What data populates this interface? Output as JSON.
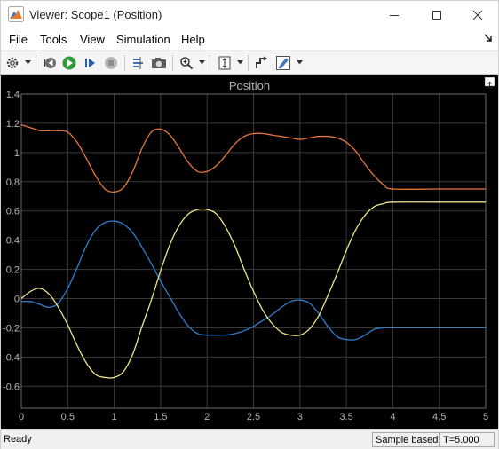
{
  "window": {
    "title": "Viewer: Scope1 (Position)"
  },
  "menu": {
    "items": [
      "File",
      "Tools",
      "View",
      "Simulation",
      "Help"
    ]
  },
  "toolbar": {
    "buttons": [
      "settings-icon",
      "step-back-icon",
      "run-icon",
      "step-forward-icon",
      "stop-icon",
      "highlight-signal-icon",
      "snapshot-icon",
      "zoom-in-icon",
      "scale-axes-icon",
      "signal-select-icon",
      "style-icon"
    ]
  },
  "plot": {
    "title": "Position"
  },
  "status": {
    "state": "Ready",
    "mode": "Sample based",
    "time": "T=5.000"
  },
  "colors": {
    "background": "#000000",
    "grid": "#3a3a3a",
    "axes_text": "#b4b4b4",
    "orange": "#e8753a",
    "blue": "#2f7fd1",
    "yellow": "#efe389"
  },
  "chart_data": {
    "type": "line",
    "title": "Position",
    "xlim": [
      0,
      5
    ],
    "ylim": [
      -0.75,
      1.4
    ],
    "xticks": [
      0,
      0.5,
      1,
      1.5,
      2,
      2.5,
      3,
      3.5,
      4,
      4.5,
      5
    ],
    "xtick_labels": [
      "0",
      "0.5",
      "1",
      "1.5",
      "2",
      "2.5",
      "3",
      "3.5",
      "4",
      "4.5",
      "5"
    ],
    "yticks": [
      -0.6,
      -0.4,
      -0.2,
      0,
      0.2,
      0.4,
      0.6,
      0.8,
      1,
      1.2,
      1.4
    ],
    "ytick_labels": [
      "-0.6",
      "-0.4",
      "-0.2",
      "0",
      "0.2",
      "0.4",
      "0.6",
      "0.8",
      "1",
      "1.2",
      "1.4"
    ],
    "grid": true,
    "series": [
      {
        "color": "#e8753a",
        "x": [
          0,
          0.1,
          0.2,
          0.3,
          0.4,
          0.5,
          0.6,
          0.7,
          0.8,
          0.9,
          1.0,
          1.1,
          1.2,
          1.3,
          1.4,
          1.5,
          1.6,
          1.7,
          1.8,
          1.9,
          2.0,
          2.1,
          2.2,
          2.3,
          2.4,
          2.5,
          2.6,
          2.7,
          2.8,
          2.9,
          3.0,
          3.1,
          3.2,
          3.3,
          3.4,
          3.5,
          3.6,
          3.7,
          3.8,
          3.9,
          4.0,
          4.5,
          5.0
        ],
        "y": [
          1.19,
          1.17,
          1.15,
          1.15,
          1.15,
          1.14,
          1.07,
          0.96,
          0.84,
          0.75,
          0.73,
          0.76,
          0.87,
          1.03,
          1.14,
          1.16,
          1.12,
          1.03,
          0.93,
          0.87,
          0.87,
          0.91,
          0.98,
          1.06,
          1.11,
          1.13,
          1.13,
          1.12,
          1.11,
          1.1,
          1.09,
          1.1,
          1.11,
          1.11,
          1.1,
          1.07,
          1.01,
          0.92,
          0.84,
          0.78,
          0.75,
          0.75,
          0.75
        ]
      },
      {
        "color": "#2f7fd1",
        "x": [
          0,
          0.1,
          0.2,
          0.3,
          0.4,
          0.5,
          0.6,
          0.7,
          0.8,
          0.9,
          1.0,
          1.1,
          1.2,
          1.3,
          1.4,
          1.5,
          1.6,
          1.7,
          1.8,
          1.9,
          2.0,
          2.1,
          2.2,
          2.3,
          2.4,
          2.5,
          2.6,
          2.7,
          2.8,
          2.9,
          3.0,
          3.1,
          3.2,
          3.3,
          3.4,
          3.5,
          3.6,
          3.7,
          3.8,
          3.9,
          4.0,
          4.5,
          5.0
        ],
        "y": [
          -0.02,
          -0.02,
          -0.04,
          -0.06,
          -0.03,
          0.07,
          0.21,
          0.36,
          0.47,
          0.52,
          0.53,
          0.51,
          0.45,
          0.35,
          0.24,
          0.12,
          0.01,
          -0.1,
          -0.19,
          -0.24,
          -0.25,
          -0.25,
          -0.25,
          -0.24,
          -0.22,
          -0.19,
          -0.15,
          -0.11,
          -0.06,
          -0.02,
          -0.01,
          -0.03,
          -0.1,
          -0.19,
          -0.26,
          -0.28,
          -0.28,
          -0.25,
          -0.21,
          -0.2,
          -0.2,
          -0.2,
          -0.2
        ]
      },
      {
        "color": "#efe389",
        "x": [
          0,
          0.1,
          0.2,
          0.3,
          0.4,
          0.5,
          0.6,
          0.7,
          0.8,
          0.9,
          1.0,
          1.1,
          1.2,
          1.3,
          1.4,
          1.5,
          1.6,
          1.7,
          1.8,
          1.9,
          2.0,
          2.1,
          2.2,
          2.3,
          2.4,
          2.5,
          2.6,
          2.7,
          2.8,
          2.9,
          3.0,
          3.1,
          3.2,
          3.3,
          3.4,
          3.5,
          3.6,
          3.7,
          3.8,
          3.9,
          4.0,
          4.5,
          5.0
        ],
        "y": [
          0.0,
          0.05,
          0.07,
          0.03,
          -0.06,
          -0.18,
          -0.32,
          -0.44,
          -0.52,
          -0.54,
          -0.54,
          -0.5,
          -0.38,
          -0.19,
          -0.01,
          0.19,
          0.37,
          0.5,
          0.58,
          0.61,
          0.61,
          0.58,
          0.49,
          0.36,
          0.2,
          0.05,
          -0.08,
          -0.17,
          -0.23,
          -0.25,
          -0.25,
          -0.21,
          -0.12,
          0.02,
          0.17,
          0.33,
          0.47,
          0.57,
          0.63,
          0.65,
          0.66,
          0.66,
          0.66
        ]
      }
    ]
  }
}
